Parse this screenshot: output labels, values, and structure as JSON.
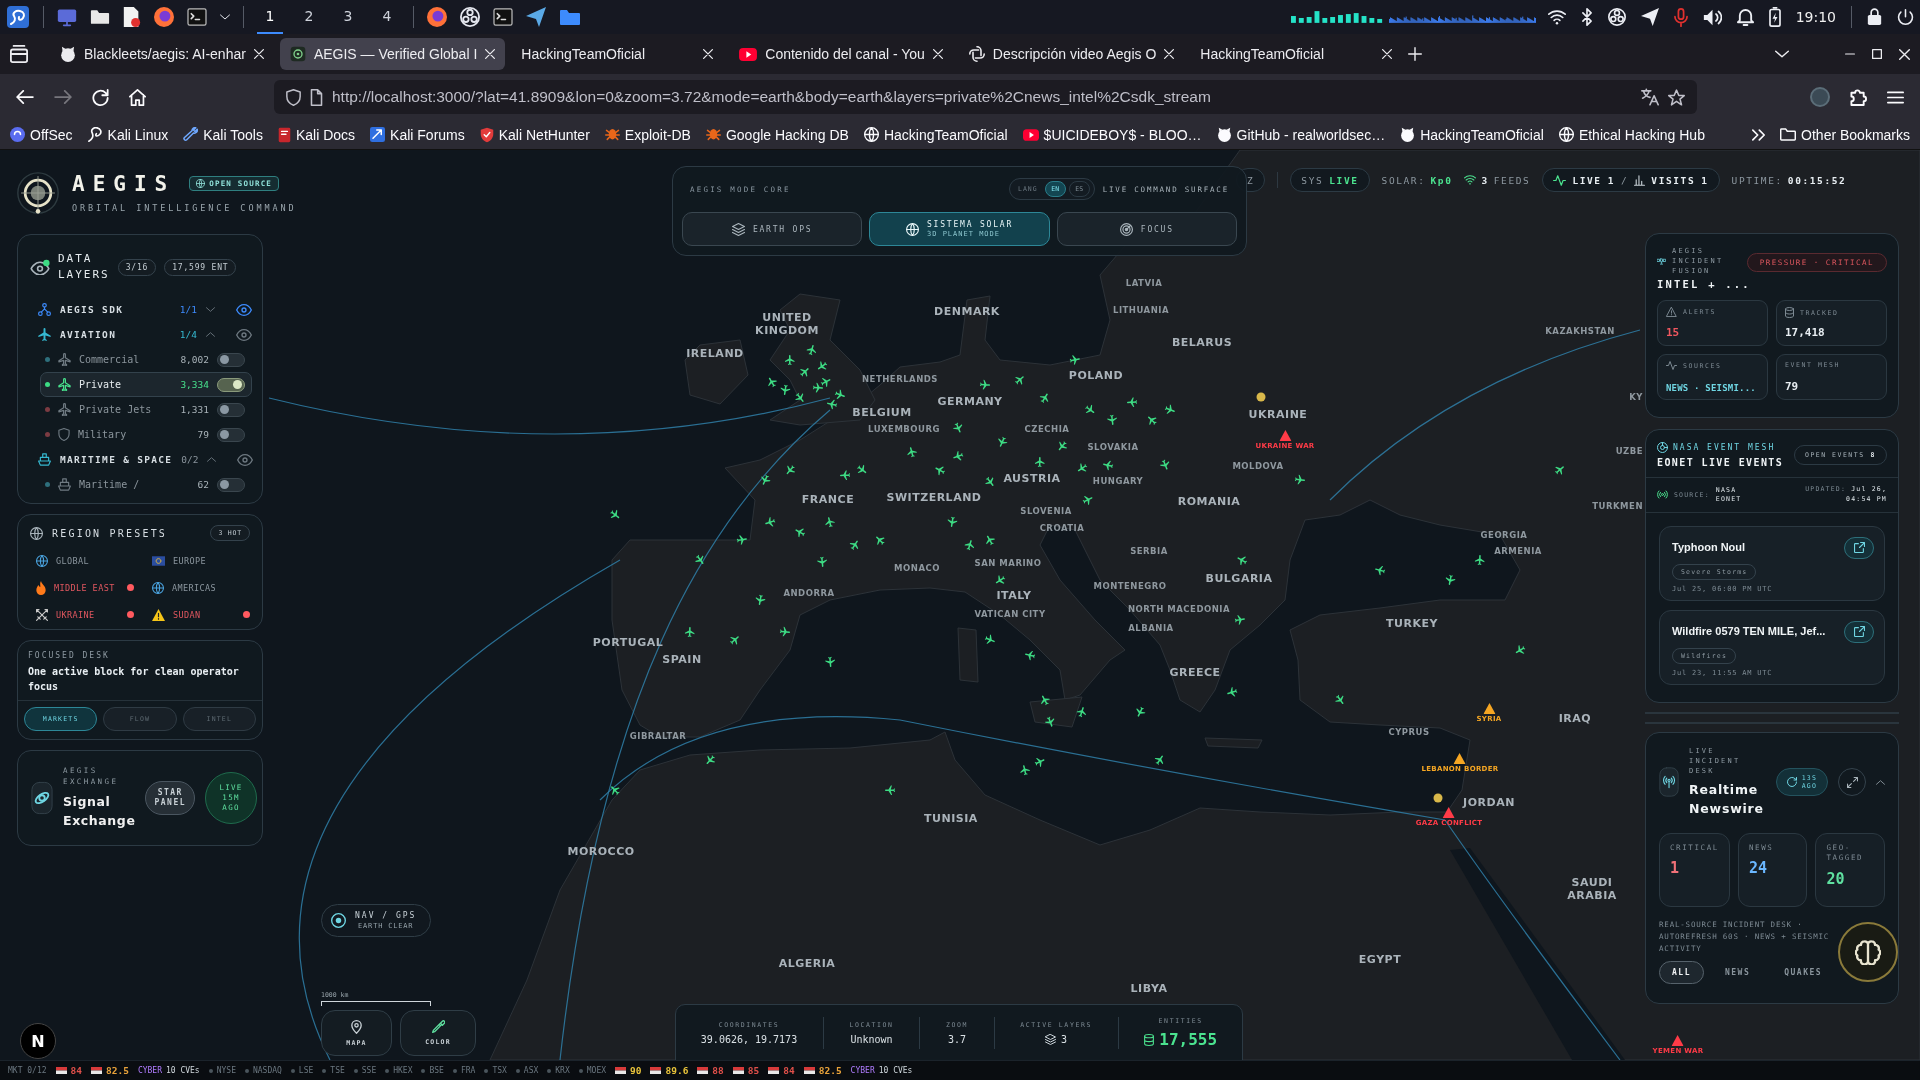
{
  "taskbar": {
    "workspaces": [
      {
        "label": "1",
        "selected": true
      },
      {
        "label": "2",
        "selected": false
      },
      {
        "label": "3",
        "selected": false
      },
      {
        "label": "4",
        "selected": false
      }
    ],
    "clock": "19:10"
  },
  "browser": {
    "tabs": [
      {
        "title": "Blackleets/aegis: AI-enhar",
        "selected": false
      },
      {
        "title": "AEGIS — Verified Global I",
        "selected": true
      },
      {
        "title": "HackingTeamOficial",
        "selected": false
      },
      {
        "title": "Contenido del canal - You",
        "selected": false
      },
      {
        "title": "Descripción video Aegis O",
        "selected": false
      },
      {
        "title": "HackingTeamOficial",
        "selected": false
      }
    ],
    "url": "http://localhost:3000/?lat=41.8909&lon=0&zoom=3.72&mode=earth&body=earth&layers=private%2Cnews_intel%2Csdk_stream",
    "bookmarks": [
      "OffSec",
      "Kali Linux",
      "Kali Tools",
      "Kali Docs",
      "Kali Forums",
      "Kali NetHunter",
      "Exploit-DB",
      "Google Hacking DB",
      "HackingTeamOficial",
      "$UICIDEBOY$ - BLOO…",
      "GitHub - realworldsec…",
      "HackingTeamOficial",
      "Ethical Hacking Hub"
    ],
    "other_bookmarks": "Other Bookmarks"
  },
  "header": {
    "title": "AEGIS",
    "badge": "OPEN SOURCE",
    "subtitle": "ORBITAL INTELLIGENCE COMMAND"
  },
  "mode_core": {
    "title": "AEGIS MODE CORE",
    "lang_label": "LANG",
    "languages": [
      {
        "label": "EN",
        "selected": true
      },
      {
        "label": "ES",
        "selected": false
      }
    ],
    "surface_label": "LIVE COMMAND SURFACE",
    "modes": [
      {
        "label": "EARTH OPS",
        "selected": false
      },
      {
        "label": "SISTEMA SOLAR",
        "sublabel": "3D PLANET MODE",
        "selected": true
      },
      {
        "label": "FOCUS",
        "selected": false
      }
    ]
  },
  "status": {
    "hidden_pill": "Z",
    "sys_label": "SYS",
    "sys_state": "LIVE",
    "solar_label": "SOLAR:",
    "solar_value": "Kp0",
    "feeds_count": "3",
    "feeds_label": "FEEDS",
    "live_label": "LIVE",
    "live_count": "1",
    "separator": "/",
    "visits_label": "VISITS",
    "visits_count": "1",
    "uptime_label": "UPTIME:",
    "uptime": "00:15:52"
  },
  "data_layers": {
    "title": "DATA LAYERS",
    "count": "3/16",
    "entities": "17,599 ENT",
    "groups": [
      {
        "kind": "sdk",
        "name": "AEGIS SDK",
        "count": "1/1",
        "expanded": false,
        "visible": true
      },
      {
        "kind": "aviation",
        "name": "AVIATION",
        "count": "1/4",
        "expanded": true,
        "visible": false,
        "children": [
          {
            "kind": "aircraft",
            "name": "Commercial",
            "count": "8,002",
            "on": false,
            "color": "#2e6f7c"
          },
          {
            "kind": "aircraft",
            "name": "Private",
            "count": "3,334",
            "on": true,
            "color": "#3ddc84"
          },
          {
            "kind": "aircraft",
            "name": "Private Jets",
            "count": "1,331",
            "on": false,
            "color": "#7c3b42"
          },
          {
            "kind": "military",
            "name": "Military",
            "count": "79",
            "on": false,
            "color": "#7c3b42"
          }
        ]
      },
      {
        "kind": "maritime",
        "name": "MARITIME & SPACE",
        "count": "0/2",
        "expanded": true,
        "visible": false,
        "children": [
          {
            "kind": "vessel",
            "name": "Maritime /",
            "count": "62",
            "on": false,
            "color": "#2e6f7c"
          }
        ]
      }
    ]
  },
  "region_presets": {
    "title": "REGION PRESETS",
    "badge": "3 HOT",
    "items": [
      {
        "label": "GLOBAL",
        "hot": false
      },
      {
        "label": "EUROPE",
        "hot": false
      },
      {
        "label": "MIDDLE EAST",
        "hot": true
      },
      {
        "label": "AMERICAS",
        "hot": false
      },
      {
        "label": "UKRAINE",
        "hot": true
      },
      {
        "label": "SUDAN",
        "hot": true
      }
    ]
  },
  "focused_desk": {
    "title": "FOCUSED DESK",
    "text": "One active block for clean operator focus",
    "tabs": [
      {
        "label": "MARKETS",
        "selected": true
      },
      {
        "label": "FLOW",
        "selected": false
      },
      {
        "label": "INTEL",
        "selected": false
      }
    ]
  },
  "exchange": {
    "eyebrow": "AEGIS EXCHANGE",
    "title": "Signal Exchange",
    "button": "STAR PANEL",
    "live": "LIVE 15M AGO"
  },
  "incident_fusion": {
    "eyebrow": "AEGIS INCIDENT FUSION",
    "title": "INTEL + ...",
    "pressure": "PRESSURE · CRITICAL",
    "tiles": [
      {
        "kind": "alerts",
        "label": "ALERTS",
        "value": "15"
      },
      {
        "kind": "tracked",
        "label": "TRACKED",
        "value": "17,418"
      },
      {
        "kind": "sources",
        "label": "SOURCES",
        "value": "NEWS · SEISMI..."
      },
      {
        "kind": "mesh",
        "label": "EVENT MESH",
        "value": "79"
      }
    ]
  },
  "eonet": {
    "eyebrow": "NASA EVENT MESH",
    "title": "EONET LIVE EVENTS",
    "open_label": "OPEN EVENTS",
    "open_count": "8",
    "source_label": "SOURCE:",
    "source": "NASA EONET",
    "updated_label": "UPDATED:",
    "updated": "Jul 26, 04:54 PM",
    "events": [
      {
        "title": "Typhoon Noul",
        "tag": "Severe Storms",
        "time": "Jul 25, 06:00 PM UTC"
      },
      {
        "title": "Wildfire 0579 TEN MILE, Jef...",
        "tag": "Wildfires",
        "time": "Jul 23, 11:55 AM UTC"
      }
    ]
  },
  "incident_desk": {
    "eyebrow": "LIVE INCIDENT DESK",
    "title": "Realtime Newswire",
    "refresh": "13S AGO",
    "stats": [
      {
        "label": "CRITICAL",
        "value": "1",
        "color": "#f07178"
      },
      {
        "label": "NEWS",
        "value": "24",
        "color": "#6ab7ff"
      },
      {
        "label": "GEO-TAGGED",
        "value": "20",
        "color": "#5fe0a0"
      }
    ],
    "description": "REAL-SOURCE INCIDENT DESK · AUTOREFRESH 60S · NEWS + SEISMIC ACTIVITY",
    "tabs": [
      {
        "label": "ALL",
        "selected": true
      },
      {
        "label": "NEWS",
        "selected": false
      },
      {
        "label": "QUAKES",
        "selected": false
      }
    ]
  },
  "map": {
    "labels": [
      "LATVIA",
      "DENMARK",
      "LITHUANIA",
      "UNITED KINGDOM",
      "IRELAND",
      "BELARUS",
      "KAZAKHSTAN",
      "NETHERLANDS",
      "POLAND",
      "GERMANY",
      "BELGIUM",
      "UKRAINE",
      "LUXEMBOURG",
      "CZECHIA",
      "SLOVAKIA",
      "MOLDOVA",
      "AUSTRIA",
      "HUNGARY",
      "FRANCE",
      "SWITZERLAND",
      "ROMANIA",
      "SLOVENIA",
      "CROATIA",
      "GEORGIA",
      "ARMENIA",
      "SERBIA",
      "MONACO",
      "SAN MARINO",
      "BULGARIA",
      "MONTENEGRO",
      "ANDORRA",
      "ITALY",
      "NORTH MACEDONIA",
      "VATICAN CITY",
      "ALBANIA",
      "TURKEY",
      "PORTUGAL",
      "SPAIN",
      "GREECE",
      "CYPRUS",
      "IRAQ",
      "GIBRALTAR",
      "JORDAN",
      "TUNISIA",
      "MOROCCO",
      "SAUDI ARABIA",
      "ALGERIA",
      "EGYPT",
      "LIBYA",
      "KY",
      "UZBE",
      "TURKMEN"
    ],
    "alerts": [
      {
        "label": "UKRAINE WAR",
        "color": "#ff3b47"
      },
      {
        "label": "SYRIA",
        "color": "#f5a623"
      },
      {
        "label": "LEBANON BORDER",
        "color": "#f5a623"
      },
      {
        "label": "GAZA CONFLICT",
        "color": "#ff3b47"
      },
      {
        "label": "YEMEN WAR",
        "color": "#ff3b47"
      }
    ],
    "nav": {
      "label": "NAV / GPS",
      "sublabel": "EARTH CLEAR"
    },
    "scale": "1000 km",
    "buttons": [
      "MAPA",
      "COLOR"
    ],
    "dev_badge": "N"
  },
  "stats_bar": {
    "fields": [
      {
        "kind": "plain",
        "label": "COORDINATES",
        "value": "39.0626, 19.7173"
      },
      {
        "kind": "plain",
        "label": "LOCATION",
        "value": "Unknown"
      },
      {
        "kind": "plain",
        "label": "ZOOM",
        "value": "3.7"
      },
      {
        "kind": "layers",
        "label": "ACTIVE LAYERS",
        "value": "3"
      },
      {
        "kind": "entities",
        "label": "ENTITIES",
        "value": "17,555"
      }
    ]
  },
  "ticker": {
    "label": "MKT 0/12",
    "items": [
      {
        "kind": "flag",
        "value": "84",
        "color": "#e0504a"
      },
      {
        "kind": "flag",
        "value": "82.5",
        "color": "#e8a23a"
      },
      {
        "kind": "cyber",
        "label": "CYBER",
        "value": "10 CVEs"
      },
      {
        "kind": "market",
        "label": "NYSE"
      },
      {
        "kind": "market",
        "label": "NASDAQ"
      },
      {
        "kind": "market",
        "label": "LSE"
      },
      {
        "kind": "market",
        "label": "TSE"
      },
      {
        "kind": "market",
        "label": "SSE"
      },
      {
        "kind": "market",
        "label": "HKEX"
      },
      {
        "kind": "market",
        "label": "BSE"
      },
      {
        "kind": "market",
        "label": "FRA"
      },
      {
        "kind": "market",
        "label": "TSX"
      },
      {
        "kind": "market",
        "label": "ASX"
      },
      {
        "kind": "market",
        "label": "KRX"
      },
      {
        "kind": "market",
        "label": "MOEX"
      },
      {
        "kind": "flag",
        "value": "90",
        "color": "#e8c33a"
      },
      {
        "kind": "flag",
        "value": "89.6",
        "color": "#e8c33a"
      },
      {
        "kind": "flag",
        "value": "88",
        "color": "#e0504a"
      },
      {
        "kind": "flag",
        "value": "85",
        "color": "#e0504a"
      },
      {
        "kind": "flag",
        "value": "84",
        "color": "#e0504a"
      },
      {
        "kind": "flag",
        "value": "82.5",
        "color": "#e8a23a"
      },
      {
        "kind": "cyber",
        "label": "CYBER",
        "value": "10 CVEs"
      }
    ]
  }
}
